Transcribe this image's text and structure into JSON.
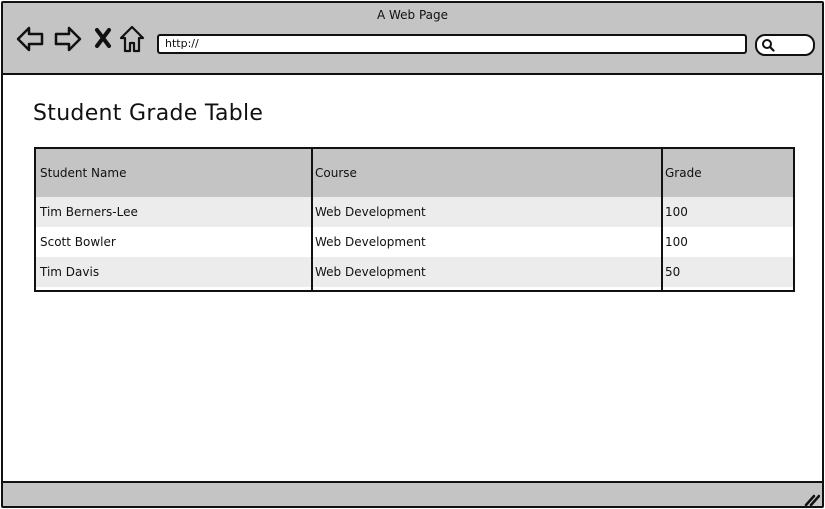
{
  "window": {
    "title": "A Web Page"
  },
  "browser": {
    "url": "http://",
    "icons": [
      "back-arrow-icon",
      "forward-arrow-icon",
      "close-x-icon",
      "home-icon",
      "search-icon",
      "resize-grip-icon"
    ]
  },
  "page": {
    "title": "Student Grade Table"
  },
  "table": {
    "headers": [
      "Student Name",
      "Course",
      "Grade"
    ],
    "rows": [
      [
        "Tim Berners-Lee",
        "Web Development",
        "100"
      ],
      [
        "Scott Bowler",
        "Web Development",
        "100"
      ],
      [
        "Tim Davis",
        "Web Development",
        "50"
      ]
    ]
  },
  "colors": {
    "chrome": "#c4c4c4",
    "row_alt": "#ececec",
    "border": "#111111"
  }
}
